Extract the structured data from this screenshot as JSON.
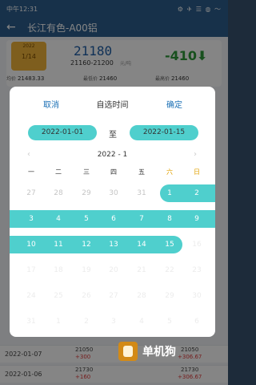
{
  "statusbar": {
    "time": "中午12:31",
    "icons": "⚙ ✈ ☰ ◍ 〜"
  },
  "appbar": {
    "back_icon": "←",
    "title": "长江有色-A00铝"
  },
  "summary": {
    "badge_top": "2022",
    "badge_date": "1/14",
    "price": "21180",
    "range": "21160-21200",
    "range_unit": "元/吨",
    "change": "-410⬇",
    "stats": [
      {
        "label": "均价",
        "value": "21483.33"
      },
      {
        "label": "最低价",
        "value": "21460"
      },
      {
        "label": "最高价",
        "value": "21460"
      }
    ]
  },
  "rows": [
    {
      "date": "2022-01-07",
      "price": "21050",
      "change": "+300",
      "price2": "21050",
      "change2": "+306.67"
    },
    {
      "date": "2022-01-06",
      "price": "21730",
      "change": "+160",
      "price2": "21730",
      "change2": "+306.67"
    }
  ],
  "dialog": {
    "cancel": "取消",
    "title": "自选时间",
    "confirm": "确定",
    "start_date": "2022-01-01",
    "to": "至",
    "end_date": "2022-01-15",
    "month": "2022 - 1",
    "prev": "‹",
    "next": "›",
    "weekdays": [
      "一",
      "二",
      "三",
      "四",
      "五",
      "六",
      "日"
    ]
  },
  "calendar": [
    [
      "27",
      "28",
      "29",
      "30",
      "31",
      "1",
      "2"
    ],
    [
      "3",
      "4",
      "5",
      "6",
      "7",
      "8",
      "9"
    ],
    [
      "10",
      "11",
      "12",
      "13",
      "14",
      "15",
      "16"
    ],
    [
      "17",
      "18",
      "19",
      "20",
      "21",
      "22",
      "23"
    ],
    [
      "24",
      "25",
      "26",
      "27",
      "28",
      "29",
      "30"
    ],
    [
      "31",
      "1",
      "2",
      "3",
      "4",
      "5",
      "6"
    ]
  ],
  "watermark": {
    "text": "单机狗"
  }
}
